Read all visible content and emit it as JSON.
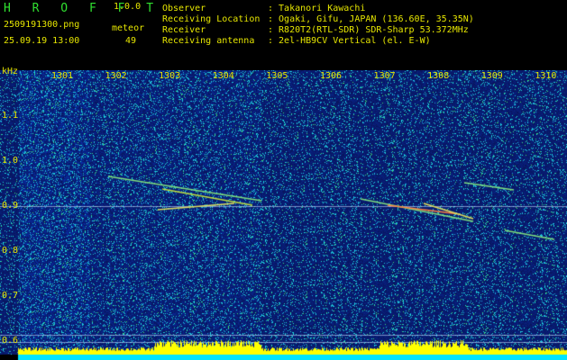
{
  "header": {
    "app_title": "H R O F F T",
    "version": "1.0.0",
    "filename": "2509191300.png",
    "datetime": "25.09.19 13:00",
    "meteor_label": "meteor",
    "meteor_count": "49"
  },
  "info": [
    {
      "label": "Observer",
      "value": ": Takanori Kawachi"
    },
    {
      "label": "Receiving Location",
      "value": ": Ogaki, Gifu, JAPAN (136.60E, 35.35N)"
    },
    {
      "label": "Receiver",
      "value": ": R820T2(RTL-SDR) SDR-Sharp 53.372MHz"
    },
    {
      "label": "Receiving antenna",
      "value": ": 2el-HB9CV Vertical (el. E-W)"
    }
  ],
  "axis": {
    "unit": "kHz",
    "y_ticks": [
      "1.1",
      "1.0",
      "0.9",
      "0.8",
      "0.7",
      "0.6"
    ],
    "x_ticks": [
      "1301",
      "1302",
      "1303",
      "1304",
      "1305",
      "1306",
      "1307",
      "1308",
      "1309",
      "1310"
    ]
  },
  "colors": {
    "text": "#e6e600",
    "title": "#30e030",
    "background_noise": "#0a2a9a",
    "power_bar": "#ffff00",
    "power_base": "#00e5ff"
  }
}
